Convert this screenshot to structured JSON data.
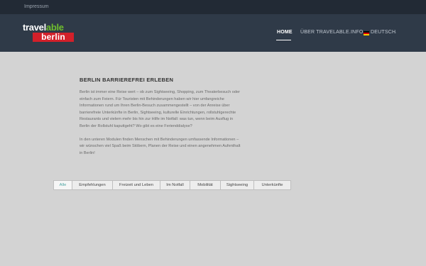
{
  "topbar": {
    "impressum": "Impressum"
  },
  "logo": {
    "line1_part1": "travel",
    "line1_part2": "able",
    "line2": "berlin"
  },
  "nav": {
    "items": [
      {
        "label": "HOME",
        "active": true
      },
      {
        "label": "ÜBER TRAVELABLE.INFO",
        "active": false
      },
      {
        "label": "DEUTSCH",
        "active": false
      }
    ]
  },
  "main": {
    "title": "BERLIN BARRIEREFREI ERLEBEN",
    "paragraph1": "Berlin ist immer eine Reise wert – ob zum Sightseeing, Shopping, zum Theaterbesuch oder einfach zum Feiern. Für Touristen mit Behinderungen haben wir hier umfangreiche Informationen rund um Ihren Berlin-Besuch zusammengestellt – von der Anreise über barrierefreie Unterkünfte in Berlin, Sightseeing, kulturelle Einrichtungen, rollstuhlgerechte Restaurants und vielem mehr bis hin zur Hilfe im Notfall: was tun, wenn beim Ausflug in Berlin der Rollstuhl kaputtgeht? Wo gibt es eine Ferienddialyse?",
    "paragraph2": "In den unteren Modulen finden Menschen mit Behinderungen umfassende Informationen – wir wünschen viel Spaß beim Stöbern, Planen der Reise und einen angenehmen Aufenthalt in Berlin!"
  },
  "filter_tabs": [
    {
      "label": "Alle",
      "active": true
    },
    {
      "label": "Empfehlungen",
      "active": false
    },
    {
      "label": "Freizeit und Leben",
      "active": false
    },
    {
      "label": "Im Notfall",
      "active": false
    },
    {
      "label": "Mobilität",
      "active": false
    },
    {
      "label": "Sightseeing",
      "active": false
    },
    {
      "label": "Unterkünfte",
      "active": false
    }
  ],
  "colors": {
    "accent": "#4aa3a0",
    "header_bg": "#2f3a48",
    "topbar_bg": "#222a35",
    "page_bg": "#d3d3d3",
    "logo_green": "#6fbe2e",
    "logo_red": "#d3202a"
  },
  "icons": {
    "language_flag": "germany-flag-icon",
    "dropdown": "chevron-down-icon"
  }
}
